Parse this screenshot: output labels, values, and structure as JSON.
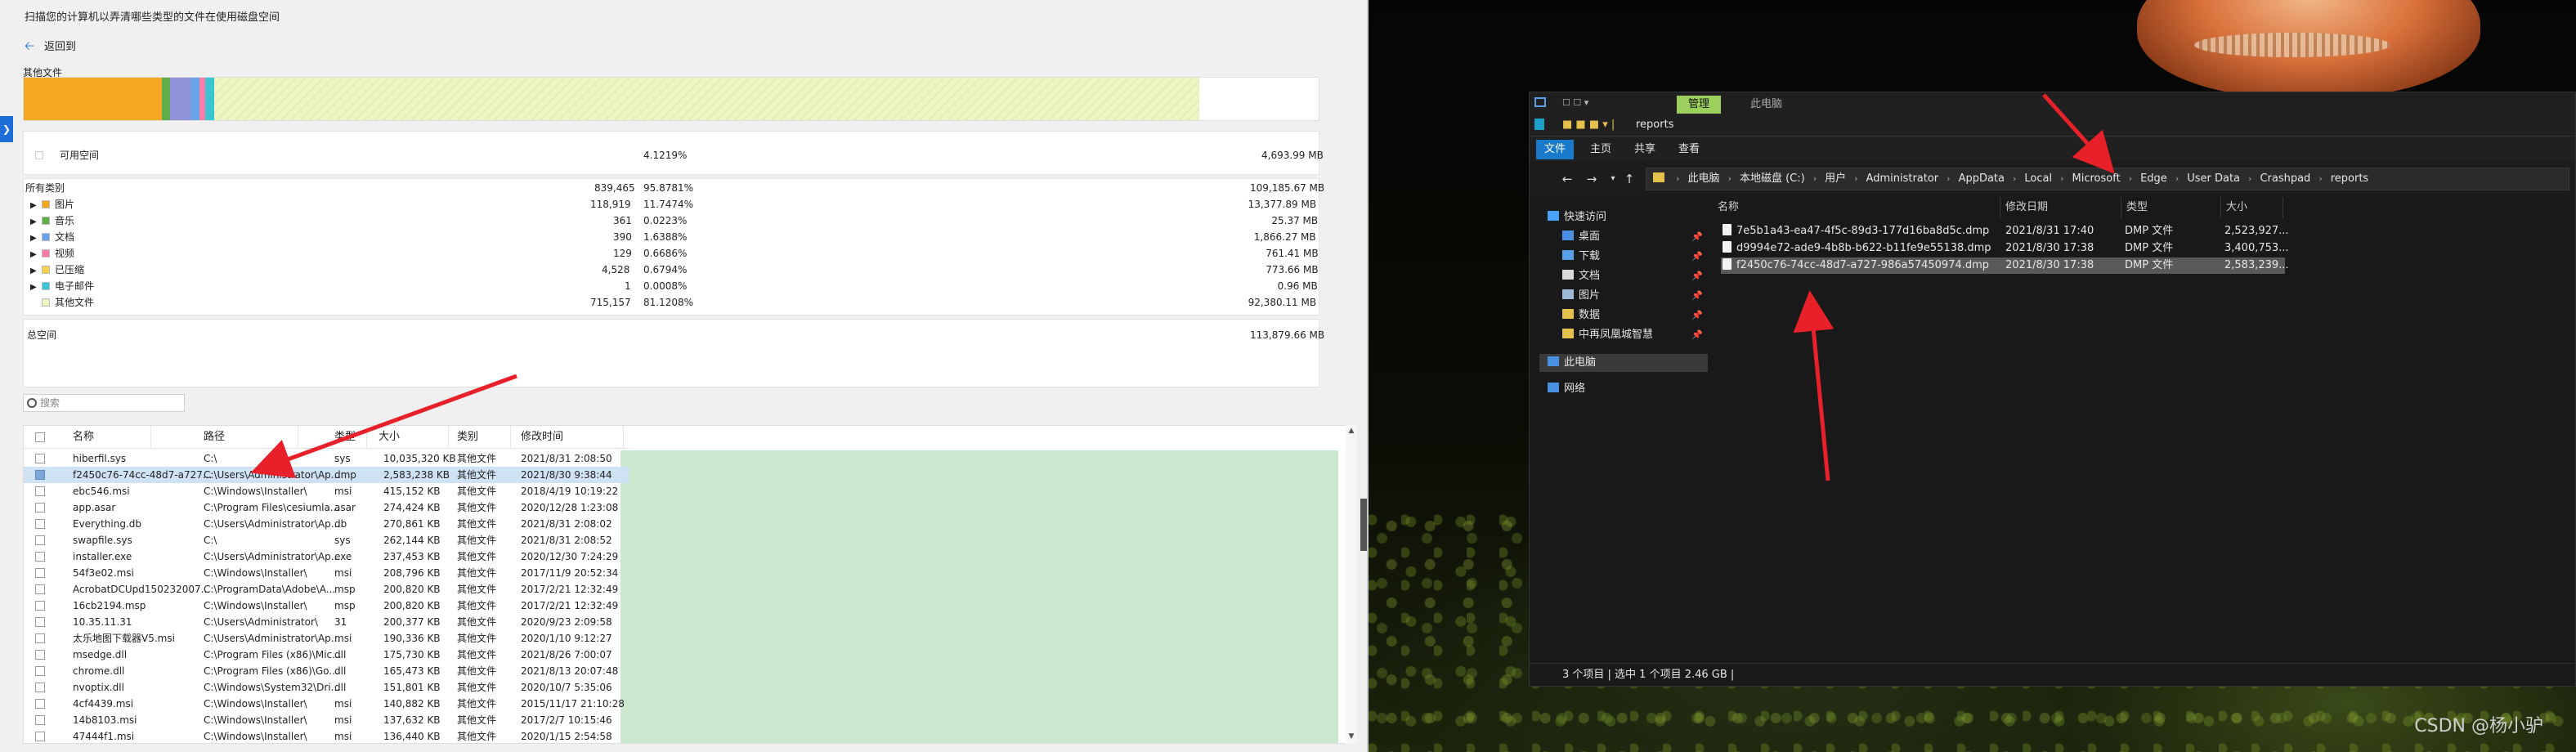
{
  "storage": {
    "title": "扫描您的计算机以弄清哪些类型的文件在使用磁盘空间",
    "back_label": "返回到",
    "top_category": "其他文件",
    "bar_colors": [
      "#f5a623",
      "#5fae4a",
      "#8e93d9",
      "#6aa3e8",
      "#ff7fa8",
      "#3bc4d4",
      "#eef5c4"
    ],
    "bar_fractions": [
      0.107,
      0.006,
      0.016,
      0.007,
      0.004,
      0.007,
      0.761
    ],
    "free": {
      "label": "可用空间",
      "percent": "4.1219%",
      "size": "4,693.99 MB"
    },
    "all_types": {
      "label": "所有类别",
      "count": "839,465",
      "percent": "95.8781%",
      "size": "109,185.67 MB"
    },
    "categories": [
      {
        "name": "图片",
        "color": "#f5a623",
        "count": "118,919",
        "percent": "11.7474%",
        "size": "13,377.89 MB"
      },
      {
        "name": "音乐",
        "color": "#5fae4a",
        "count": "361",
        "percent": "0.0223%",
        "size": "25.37 MB"
      },
      {
        "name": "文档",
        "color": "#6aa3e8",
        "count": "390",
        "percent": "1.6388%",
        "size": "1,866.27 MB"
      },
      {
        "name": "视频",
        "color": "#ff7fa8",
        "count": "129",
        "percent": "0.6686%",
        "size": "761.41 MB"
      },
      {
        "name": "已压缩",
        "color": "#f5d04a",
        "count": "4,528",
        "percent": "0.6794%",
        "size": "773.66 MB"
      },
      {
        "name": "电子邮件",
        "color": "#3bc4d4",
        "count": "1",
        "percent": "0.0008%",
        "size": "0.96 MB"
      },
      {
        "name": "其他文件",
        "color": "#eef5c4",
        "count": "715,157",
        "percent": "81.1208%",
        "size": "92,380.11 MB"
      }
    ],
    "total": {
      "label": "总空间",
      "size": "113,879.66 MB"
    },
    "search_placeholder": "搜索",
    "columns": [
      "名称",
      "路径",
      "类型",
      "大小",
      "类别",
      "修改时间"
    ],
    "files": [
      {
        "name": "hiberfil.sys",
        "path": "C:\\",
        "type": "sys",
        "size": "10,035,320 KB",
        "cat": "其他文件",
        "date": "2021/8/31 2:08:50"
      },
      {
        "name": "f2450c76-74cc-48d7-a727...",
        "path": "C:\\Users\\Administrator\\Ap...",
        "type": "dmp",
        "size": "2,583,238 KB",
        "cat": "其他文件",
        "date": "2021/8/30 9:38:44",
        "selected": true
      },
      {
        "name": "ebc546.msi",
        "path": "C:\\Windows\\Installer\\",
        "type": "msi",
        "size": "415,152 KB",
        "cat": "其他文件",
        "date": "2018/4/19 10:19:22"
      },
      {
        "name": "app.asar",
        "path": "C:\\Program Files\\cesiumla...",
        "type": "asar",
        "size": "274,424 KB",
        "cat": "其他文件",
        "date": "2020/12/28 1:23:08"
      },
      {
        "name": "Everything.db",
        "path": "C:\\Users\\Administrator\\Ap...",
        "type": "db",
        "size": "270,861 KB",
        "cat": "其他文件",
        "date": "2021/8/31 2:08:02"
      },
      {
        "name": "swapfile.sys",
        "path": "C:\\",
        "type": "sys",
        "size": "262,144 KB",
        "cat": "其他文件",
        "date": "2021/8/31 2:08:52"
      },
      {
        "name": "installer.exe",
        "path": "C:\\Users\\Administrator\\Ap...",
        "type": "exe",
        "size": "237,453 KB",
        "cat": "其他文件",
        "date": "2020/12/30 7:24:29"
      },
      {
        "name": "54f3e02.msi",
        "path": "C:\\Windows\\Installer\\",
        "type": "msi",
        "size": "208,796 KB",
        "cat": "其他文件",
        "date": "2017/11/9 20:52:34"
      },
      {
        "name": "AcrobatDCUpd150232007...",
        "path": "C:\\ProgramData\\Adobe\\A...",
        "type": "msp",
        "size": "200,820 KB",
        "cat": "其他文件",
        "date": "2017/2/21 12:32:49"
      },
      {
        "name": "16cb2194.msp",
        "path": "C:\\Windows\\Installer\\",
        "type": "msp",
        "size": "200,820 KB",
        "cat": "其他文件",
        "date": "2017/2/21 12:32:49"
      },
      {
        "name": "10.35.11.31",
        "path": "C:\\Users\\Administrator\\",
        "type": "31",
        "size": "200,377 KB",
        "cat": "其他文件",
        "date": "2020/9/23 2:09:58"
      },
      {
        "name": "太乐地图下载器V5.msi",
        "path": "C:\\Users\\Administrator\\Ap...",
        "type": "msi",
        "size": "190,336 KB",
        "cat": "其他文件",
        "date": "2020/1/10 9:12:27"
      },
      {
        "name": "msedge.dll",
        "path": "C:\\Program Files (x86)\\Mic...",
        "type": "dll",
        "size": "175,730 KB",
        "cat": "其他文件",
        "date": "2021/8/26 7:00:07"
      },
      {
        "name": "chrome.dll",
        "path": "C:\\Program Files (x86)\\Go...",
        "type": "dll",
        "size": "165,473 KB",
        "cat": "其他文件",
        "date": "2021/8/13 20:07:48"
      },
      {
        "name": "nvoptix.dll",
        "path": "C:\\Windows\\System32\\Dri...",
        "type": "dll",
        "size": "151,801 KB",
        "cat": "其他文件",
        "date": "2020/10/7 5:35:06"
      },
      {
        "name": "4cf4439.msi",
        "path": "C:\\Windows\\Installer\\",
        "type": "msi",
        "size": "140,882 KB",
        "cat": "其他文件",
        "date": "2015/11/17 21:10:28"
      },
      {
        "name": "14b8103.msi",
        "path": "C:\\Windows\\Installer\\",
        "type": "msi",
        "size": "137,632 KB",
        "cat": "其他文件",
        "date": "2017/2/7 10:15:46"
      },
      {
        "name": "47444f1.msi",
        "path": "C:\\Windows\\Installer\\",
        "type": "msi",
        "size": "136,440 KB",
        "cat": "其他文件",
        "date": "2020/1/15 2:54:58"
      }
    ]
  },
  "explorer": {
    "window_title": "reports",
    "manage_tab": "管理",
    "thispc_tab": "此电脑",
    "ribbon_tabs": [
      "文件",
      "主页",
      "共享",
      "查看"
    ],
    "breadcrumb": [
      "此电脑",
      "本地磁盘 (C:)",
      "用户",
      "Administrator",
      "AppData",
      "Local",
      "Microsoft",
      "Edge",
      "User Data",
      "Crashpad",
      "reports"
    ],
    "nav": [
      {
        "label": "快速访问",
        "icon": "star-icon",
        "indent": 0
      },
      {
        "label": "桌面",
        "icon": "desktop-icon",
        "indent": 1,
        "pinned": true
      },
      {
        "label": "下载",
        "icon": "download-icon",
        "indent": 1,
        "pinned": true
      },
      {
        "label": "文档",
        "icon": "document-icon",
        "indent": 1,
        "pinned": true
      },
      {
        "label": "图片",
        "icon": "picture-icon",
        "indent": 1,
        "pinned": true
      },
      {
        "label": "数据",
        "icon": "folder-icon",
        "indent": 1,
        "pinned": true
      },
      {
        "label": "中再凤凰城智慧",
        "icon": "folder-icon",
        "indent": 1,
        "pinned": true
      },
      {
        "label": "此电脑",
        "icon": "computer-icon",
        "indent": 0,
        "selected": true
      },
      {
        "label": "网络",
        "icon": "network-icon",
        "indent": 0
      }
    ],
    "columns": [
      "名称",
      "修改日期",
      "类型",
      "大小"
    ],
    "files": [
      {
        "name": "7e5b1a43-ea47-4f5c-89d3-177d16ba8d5c.dmp",
        "date": "2021/8/31 17:40",
        "type": "DMP 文件",
        "size": "2,523,927..."
      },
      {
        "name": "d9994e72-ade9-4b8b-b622-b11fe9e55138.dmp",
        "date": "2021/8/30 17:38",
        "type": "DMP 文件",
        "size": "3,400,753..."
      },
      {
        "name": "f2450c76-74cc-48d7-a727-986a57450974.dmp",
        "date": "2021/8/30 17:38",
        "type": "DMP 文件",
        "size": "2,583,239...",
        "selected": true
      }
    ],
    "status": "3 个项目  |  选中 1 个项目  2.46 GB  |"
  },
  "watermark": "CSDN @杨小驴",
  "colors": {
    "accent": "#1e6ed8",
    "arrow": "#e8202a",
    "grid_fill": "#cbe8cf",
    "explorer_bg": "#191919"
  }
}
